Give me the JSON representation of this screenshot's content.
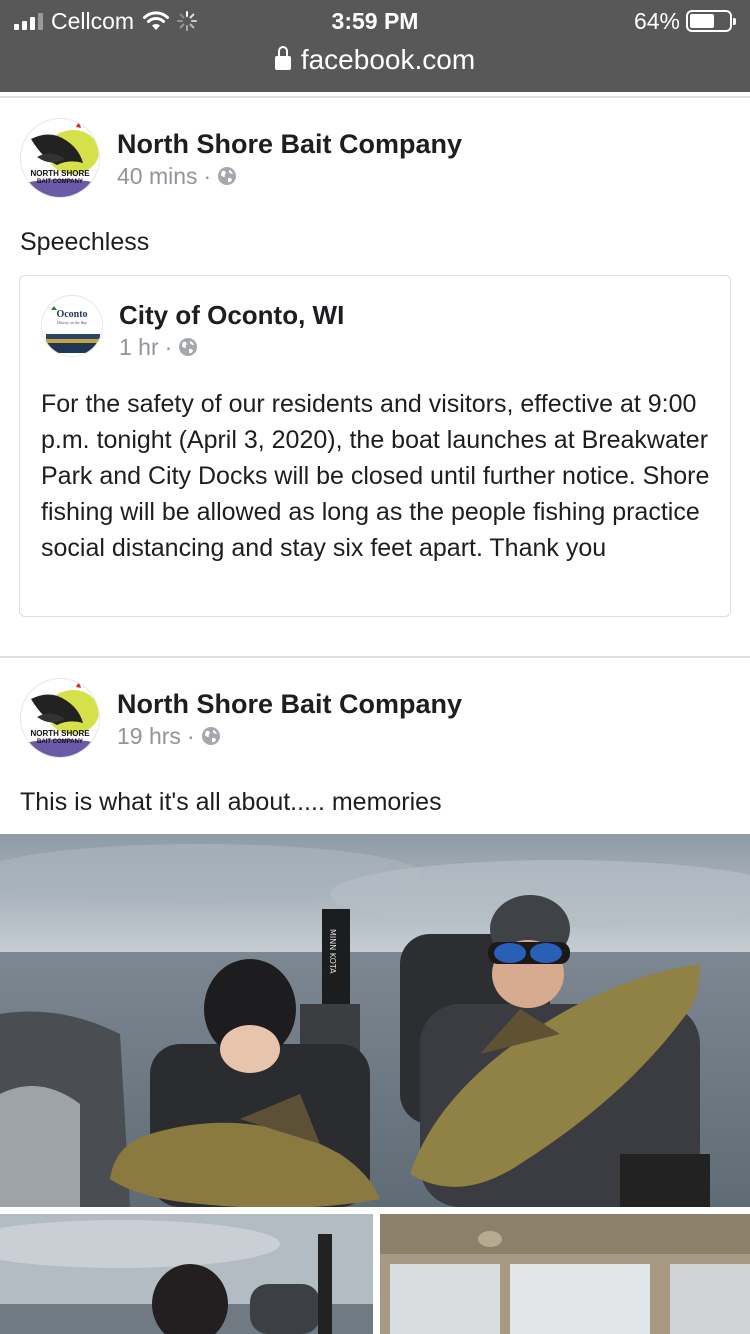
{
  "status_bar": {
    "carrier": "Cellcom",
    "time": "3:59 PM",
    "battery": "64%",
    "battery_level": 0.64
  },
  "address_bar": {
    "url": "facebook.com"
  },
  "posts": [
    {
      "author": "North Shore Bait Company",
      "avatar_text": [
        "NORTH SHORE",
        "BAIT COMPANY"
      ],
      "time": "40 mins",
      "text": "Speechless",
      "shared": {
        "author": "City of Oconto, WI",
        "avatar_text": [
          "Oconto",
          "History on the Bay"
        ],
        "time": "1 hr",
        "body": "For the safety of our residents and visitors, effective at 9:00 p.m. tonight (April 3, 2020), the boat launches at Breakwater Park and City Docks will be closed until further notice. Shore fishing will be allowed as long as the people fishing practice social distancing and stay six feet apart. Thank you"
      }
    },
    {
      "author": "North Shore Bait Company",
      "avatar_text": [
        "NORTH SHORE",
        "BAIT COMPANY"
      ],
      "time": "19 hrs",
      "text": "This is what it's all about..... memories",
      "photo_brand": "MINN KOTA"
    }
  ],
  "separator": "·",
  "icons": {
    "globe": "globe-icon",
    "lock": "lock-icon",
    "wifi": "wifi-icon",
    "signal": "signal-icon",
    "battery": "battery-icon"
  },
  "colors": {
    "status_bar": "#585858",
    "secondary_text": "#90949c",
    "divider": "#dddfe2"
  }
}
